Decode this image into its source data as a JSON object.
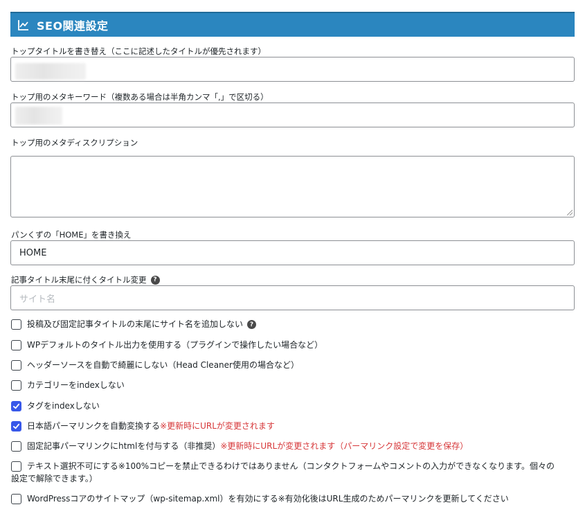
{
  "section": {
    "title": "SEO関連設定",
    "icon": "chart-line-icon"
  },
  "fields": {
    "top_title": {
      "label": "トップタイトルを書き替え（ここに記述したタイトルが優先されます）",
      "value": ""
    },
    "top_keywords": {
      "label": "トップ用のメタキーワード（複数ある場合は半角カンマ「,」で区切る）",
      "value": ""
    },
    "top_description": {
      "label": "トップ用のメタディスクリプション",
      "value": ""
    },
    "breadcrumb_home": {
      "label": "パンくずの「HOME」を書き換え",
      "value": "HOME"
    },
    "title_suffix": {
      "label": "記事タイトル末尾に付くタイトル変更",
      "placeholder": "サイト名"
    }
  },
  "checkboxes": [
    {
      "label": "投稿及び固定記事タイトルの末尾にサイト名を追加しない",
      "warning": "",
      "checked": false,
      "help": true
    },
    {
      "label": "WPデフォルトのタイトル出力を使用する（プラグインで操作したい場合など）",
      "warning": "",
      "checked": false,
      "help": false
    },
    {
      "label": "ヘッダーソースを自動で綺麗にしない（Head Cleaner使用の場合など）",
      "warning": "",
      "checked": false,
      "help": false
    },
    {
      "label": "カテゴリーをindexしない",
      "warning": "",
      "checked": false,
      "help": false
    },
    {
      "label": "タグをindexしない",
      "warning": "",
      "checked": true,
      "help": false
    },
    {
      "label": "日本語パーマリンクを自動変換する",
      "warning": "※更新時にURLが変更されます",
      "checked": true,
      "help": false
    },
    {
      "label": "固定記事パーマリンクにhtmlを付与する（非推奨）",
      "warning": "※更新時にURLが変更されます（パーマリンク設定で変更を保存）",
      "checked": false,
      "help": false
    },
    {
      "label": "テキスト選択不可にする※100%コピーを禁止できるわけではありません（コンタクトフォームやコメントの入力ができなくなります。個々の設定で解除できます。）",
      "warning": "",
      "checked": false,
      "help": false
    },
    {
      "label": "WordPressコアのサイトマップ（wp-sitemap.xml）を有効にする※有効化後はURL生成のためパーマリンクを更新してください",
      "warning": "",
      "checked": false,
      "help": false
    }
  ],
  "help_symbol": "?",
  "colors": {
    "header_bg": "#2b86bf",
    "checkbox_checked": "#3858e9",
    "warning": "#d63638"
  }
}
